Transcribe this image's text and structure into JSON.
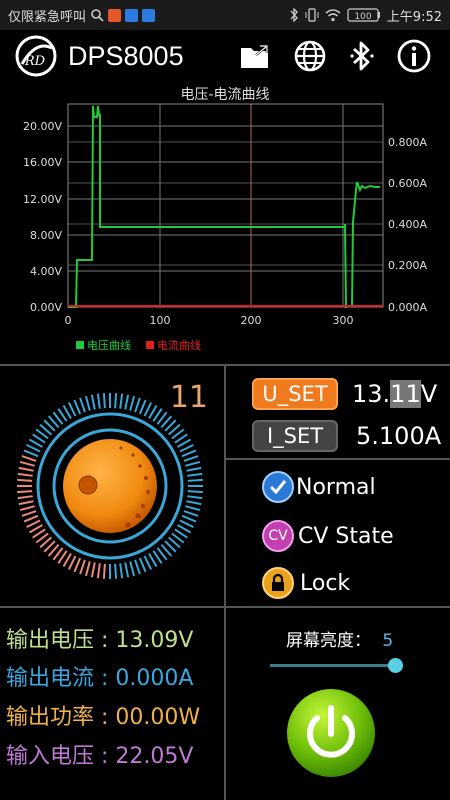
{
  "status_bar": {
    "carrier": "仅限紧急呼叫",
    "battery": "100",
    "time": "上午9:52"
  },
  "app": {
    "title": "DPS8005"
  },
  "graph": {
    "title": "电压-电流曲线",
    "left_ticks": [
      "20.00V",
      "16.00V",
      "12.00V",
      "8.00V",
      "4.00V",
      "0.00V"
    ],
    "right_ticks": [
      "0.800A",
      "0.600A",
      "0.400A",
      "0.200A",
      "0.000A"
    ],
    "x_ticks": [
      "0",
      "100",
      "200",
      "300"
    ],
    "legend": [
      {
        "label": "电压曲线",
        "color": "#22c93a"
      },
      {
        "label": "电流曲线",
        "color": "#e02020"
      }
    ]
  },
  "knob": {
    "count": "11"
  },
  "settings": {
    "u_label": "U_SET",
    "u_value_prefix": "13.",
    "u_value_sel": "11",
    "u_value_suffix": "V",
    "i_label": "I_SET",
    "i_value": "5.100A"
  },
  "states": {
    "normal": "Normal",
    "cv": "CV State",
    "cv_badge": "CV",
    "lock": "Lock"
  },
  "readouts": {
    "out_voltage_label": "输出电压",
    "out_voltage": "13.09V",
    "out_current_label": "输出电流",
    "out_current": "0.000A",
    "out_power_label": "输出功率",
    "out_power": "00.00W",
    "in_voltage_label": "输入电压",
    "in_voltage": "22.05V"
  },
  "brightness": {
    "label": "屏幕亮度：",
    "value": "5",
    "level": 0.95
  }
}
